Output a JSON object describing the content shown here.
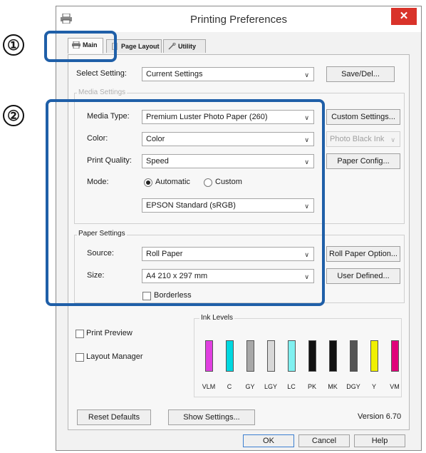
{
  "window": {
    "title": "Printing Preferences",
    "close_glyph": "✕"
  },
  "callouts": {
    "one": "①",
    "two": "②"
  },
  "tabs": [
    {
      "label": "Main",
      "icon": "printer-icon"
    },
    {
      "label": "Page Layout",
      "icon": "page-icon"
    },
    {
      "label": "Utility",
      "icon": "wrench-icon"
    }
  ],
  "select_setting": {
    "label": "Select Setting:",
    "value": "Current Settings",
    "button": "Save/Del..."
  },
  "media_settings": {
    "group_label": "Media Settings",
    "media_type": {
      "label": "Media Type:",
      "value": "Premium Luster Photo Paper (260)",
      "button": "Custom Settings..."
    },
    "color": {
      "label": "Color:",
      "value": "Color",
      "ink_select": "Photo Black Ink"
    },
    "print_quality": {
      "label": "Print Quality:",
      "value": "Speed",
      "button": "Paper Config..."
    },
    "mode": {
      "label": "Mode:",
      "automatic": "Automatic",
      "custom": "Custom",
      "selected": "Automatic",
      "profile": "EPSON Standard (sRGB)"
    }
  },
  "paper_settings": {
    "group_label": "Paper Settings",
    "source": {
      "label": "Source:",
      "value": "Roll Paper",
      "button": "Roll Paper Option..."
    },
    "size": {
      "label": "Size:",
      "value": "A4 210 x 297 mm",
      "button": "User Defined..."
    },
    "borderless": {
      "label": "Borderless",
      "checked": false
    }
  },
  "options": {
    "print_preview": {
      "label": "Print Preview",
      "checked": false
    },
    "layout_manager": {
      "label": "Layout Manager",
      "checked": false
    }
  },
  "ink_levels": {
    "title": "Ink Levels",
    "inks": [
      {
        "code": "VLM",
        "color": "#e040e0",
        "level": 0.75
      },
      {
        "code": "C",
        "color": "#00d8e0",
        "level": 0.75
      },
      {
        "code": "GY",
        "color": "#a8a8a8",
        "level": 0.75
      },
      {
        "code": "LGY",
        "color": "#d8d8d8",
        "level": 0.75
      },
      {
        "code": "LC",
        "color": "#80f0f0",
        "level": 0.75
      },
      {
        "code": "PK",
        "color": "#111111",
        "level": 0.75
      },
      {
        "code": "MK",
        "color": "#111111",
        "level": 0.75
      },
      {
        "code": "DGY",
        "color": "#555555",
        "level": 0.75
      },
      {
        "code": "Y",
        "color": "#f0f000",
        "level": 0.75
      },
      {
        "code": "VM",
        "color": "#e0007a",
        "level": 0.75
      }
    ]
  },
  "footer": {
    "reset": "Reset Defaults",
    "show_settings": "Show Settings...",
    "version": "Version 6.70",
    "ok": "OK",
    "cancel": "Cancel",
    "help": "Help"
  }
}
